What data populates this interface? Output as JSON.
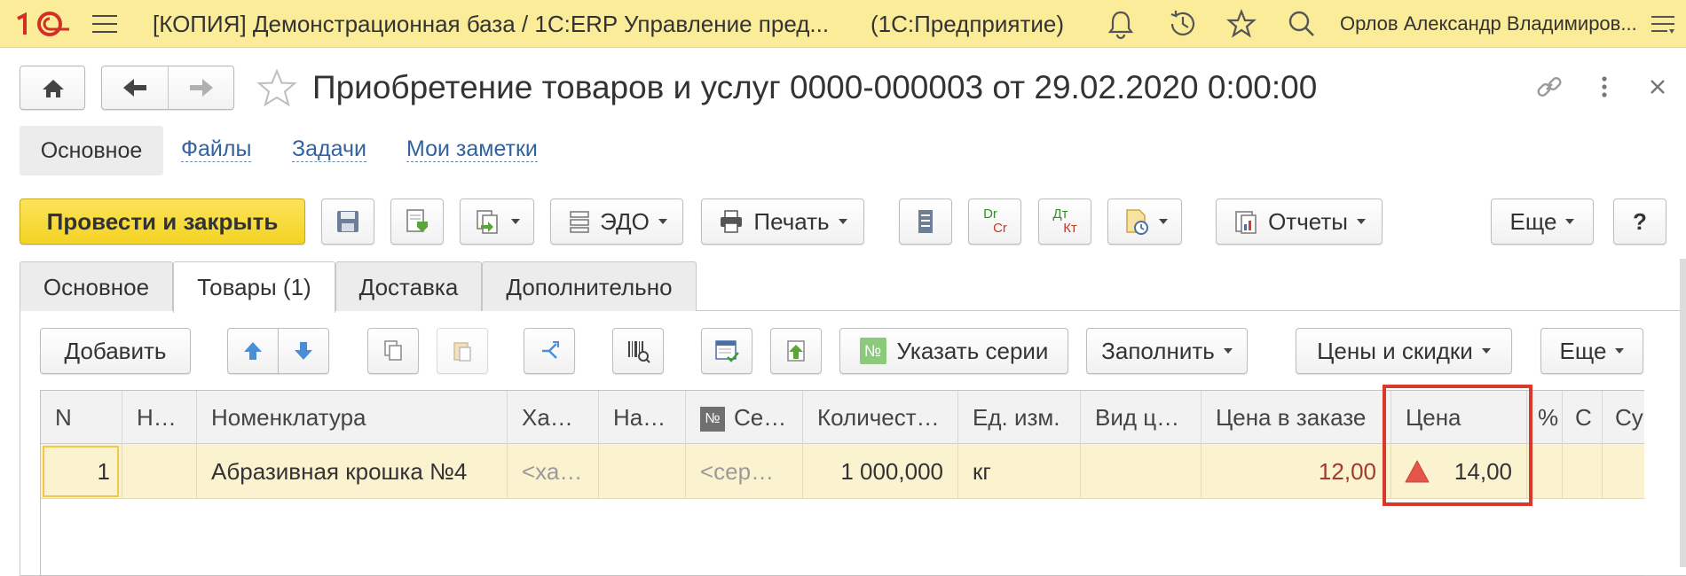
{
  "topbar": {
    "logo": "1С",
    "app_title": "[КОПИЯ] Демонстрационная база / 1С:ERP Управление пред...",
    "mode": "(1С:Предприятие)",
    "user": "Орлов Александр Владимиров...",
    "icons": [
      "bell-icon",
      "history-icon",
      "star-icon",
      "search-icon",
      "menu-icon"
    ]
  },
  "doc": {
    "title": "Приобретение товаров и услуг 0000-000003 от 29.02.2020 0:00:00"
  },
  "sections": {
    "active": "Основное",
    "links": [
      "Файлы",
      "Задачи",
      "Мои заметки"
    ]
  },
  "toolbar": {
    "post_close": "Провести и закрыть",
    "edo": "ЭДО",
    "print": "Печать",
    "reports": "Отчеты",
    "more": "Еще",
    "help": "?",
    "dt": "Dr",
    "ct": "Cr",
    "dt_ru": "Дт",
    "kt_ru": "Кт"
  },
  "tabs": [
    "Основное",
    "Товары (1)",
    "Доставка",
    "Дополнительно"
  ],
  "active_tab": "Товары (1)",
  "grid_toolbar": {
    "add": "Добавить",
    "series": "Указать серии",
    "series_icon": "№",
    "fill": "Заполнить",
    "prices": "Цены и скидки",
    "more": "Еще"
  },
  "table": {
    "columns": [
      "N",
      "Н…",
      "Номенклатура",
      "Ха…",
      "На…",
      "Се…",
      "Количест…",
      "Ед. изм.",
      "Вид ц…",
      "Цена в заказе",
      "Цена",
      "%",
      "С",
      "Су"
    ],
    "series_col_icon": "№",
    "rows": [
      {
        "n": "1",
        "h": "",
        "item": "Абразивная крошка №4",
        "char": "<ха…",
        "na": "",
        "series": "<сер…",
        "qty": "1 000,000",
        "unit": "кг",
        "price_type": "",
        "order_price": "12,00",
        "price": "14,00"
      }
    ]
  },
  "colors": {
    "topbar": "#fbec9a",
    "primary_button": "#f4d323",
    "link": "#33639f",
    "row_selected": "#fbf2d0",
    "highlight": "#d9382a",
    "warning": "#e4564a"
  }
}
